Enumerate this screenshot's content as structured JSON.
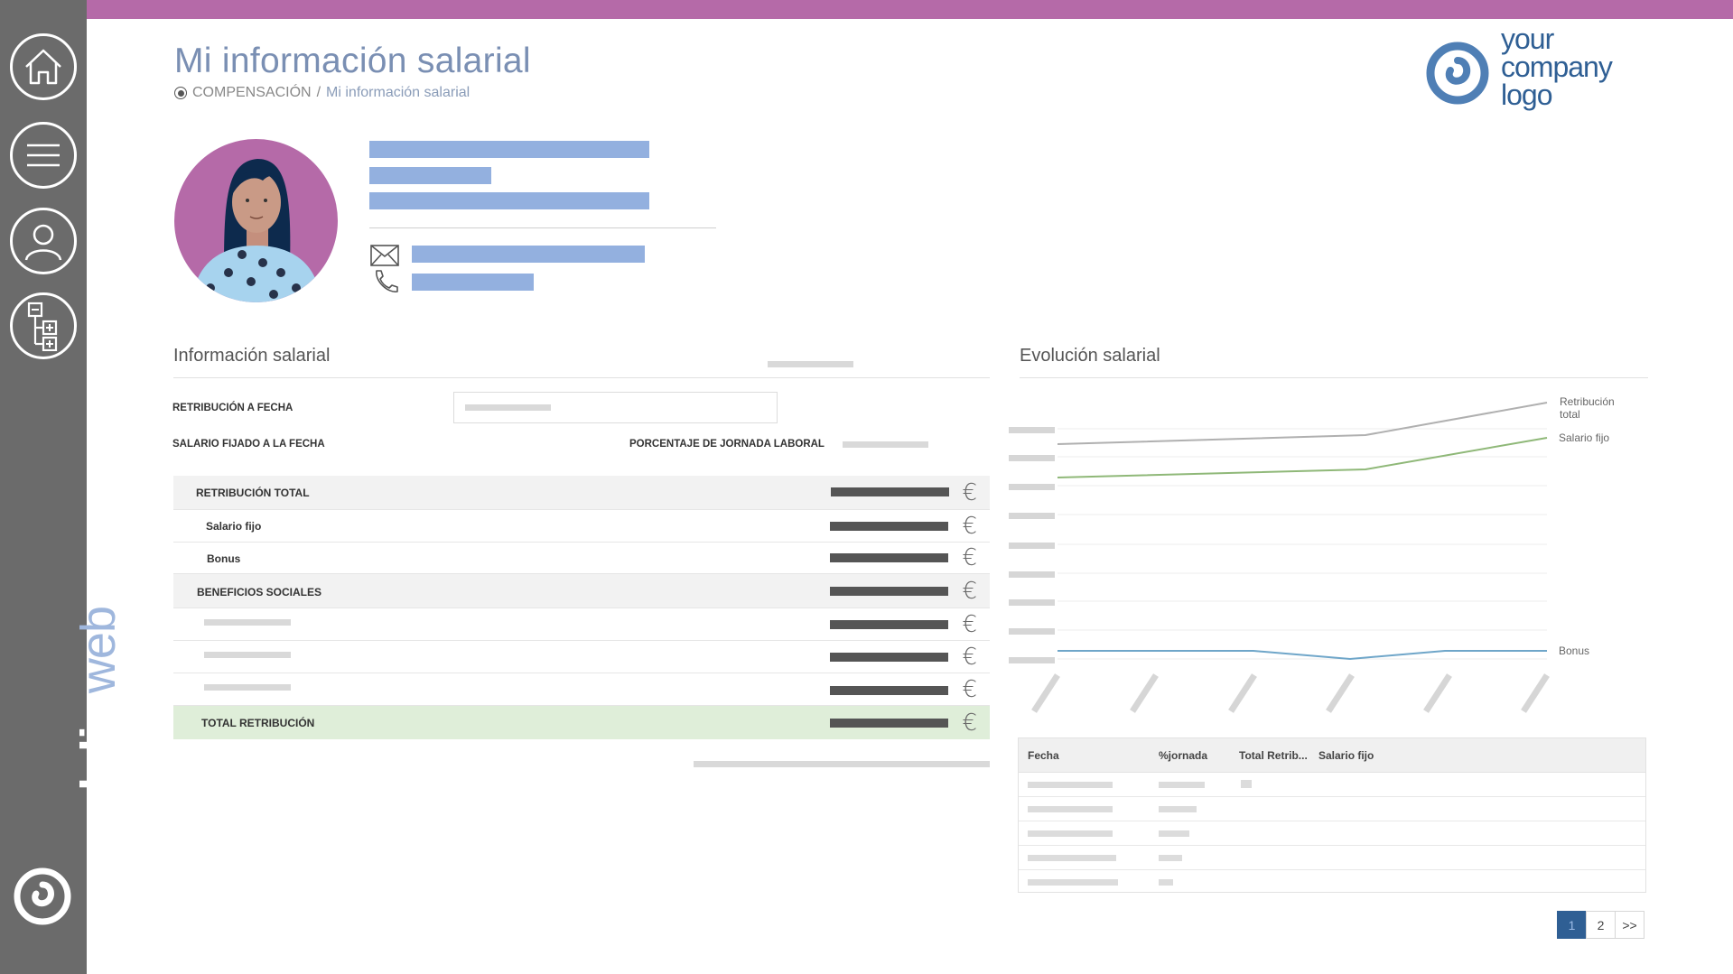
{
  "app": {
    "brand_bold": "endalia",
    "brand_registered": "®",
    "brand_light": "web",
    "accent_color": "#b56aa8",
    "sidebar_color": "#6b6b6b",
    "brand_blue": "#2f5f94"
  },
  "sidebar": {
    "items": [
      {
        "name": "home",
        "icon": "home-icon"
      },
      {
        "name": "menu",
        "icon": "hamburger-icon"
      },
      {
        "name": "profile",
        "icon": "user-icon"
      },
      {
        "name": "org-chart",
        "icon": "org-chart-icon"
      }
    ]
  },
  "header": {
    "title": "Mi información salarial",
    "breadcrumb_section": "COMPENSACIÓN",
    "breadcrumb_separator": "/",
    "breadcrumb_current": "Mi información salarial"
  },
  "logo": {
    "line1": "your",
    "line2": "company",
    "line3": "logo"
  },
  "salary_info": {
    "title": "Información salarial",
    "retribucion_a_fecha_label": "RETRIBUCIÓN A FECHA",
    "salario_fijado_label": "SALARIO FIJADO A LA FECHA",
    "porcentaje_jornada_label": "PORCENTAJE DE JORNADA LABORAL",
    "rows": {
      "retribucion_total": "RETRIBUCIÓN TOTAL",
      "salario_fijo": "Salario fijo",
      "bonus": "Bonus",
      "beneficios_sociales": "BENEFICIOS SOCIALES",
      "total_retribucion": "TOTAL RETRIBUCIÓN"
    },
    "currency_symbol": "€"
  },
  "evolution": {
    "title": "Evolución salarial",
    "series_labels": {
      "total_line1": "Retribución",
      "total_line2": "total",
      "fijo": "Salario fijo",
      "bonus": "Bonus"
    },
    "colors": {
      "total": "#b0b0b0",
      "fijo": "#8fb878",
      "bonus": "#6fa6c9"
    }
  },
  "history_table": {
    "columns": [
      "Fecha",
      "%jornada",
      "Total Retrib...",
      "Salario fijo"
    ]
  },
  "pagination": {
    "pages": [
      "1",
      "2"
    ],
    "next": ">>",
    "active": "1"
  }
}
